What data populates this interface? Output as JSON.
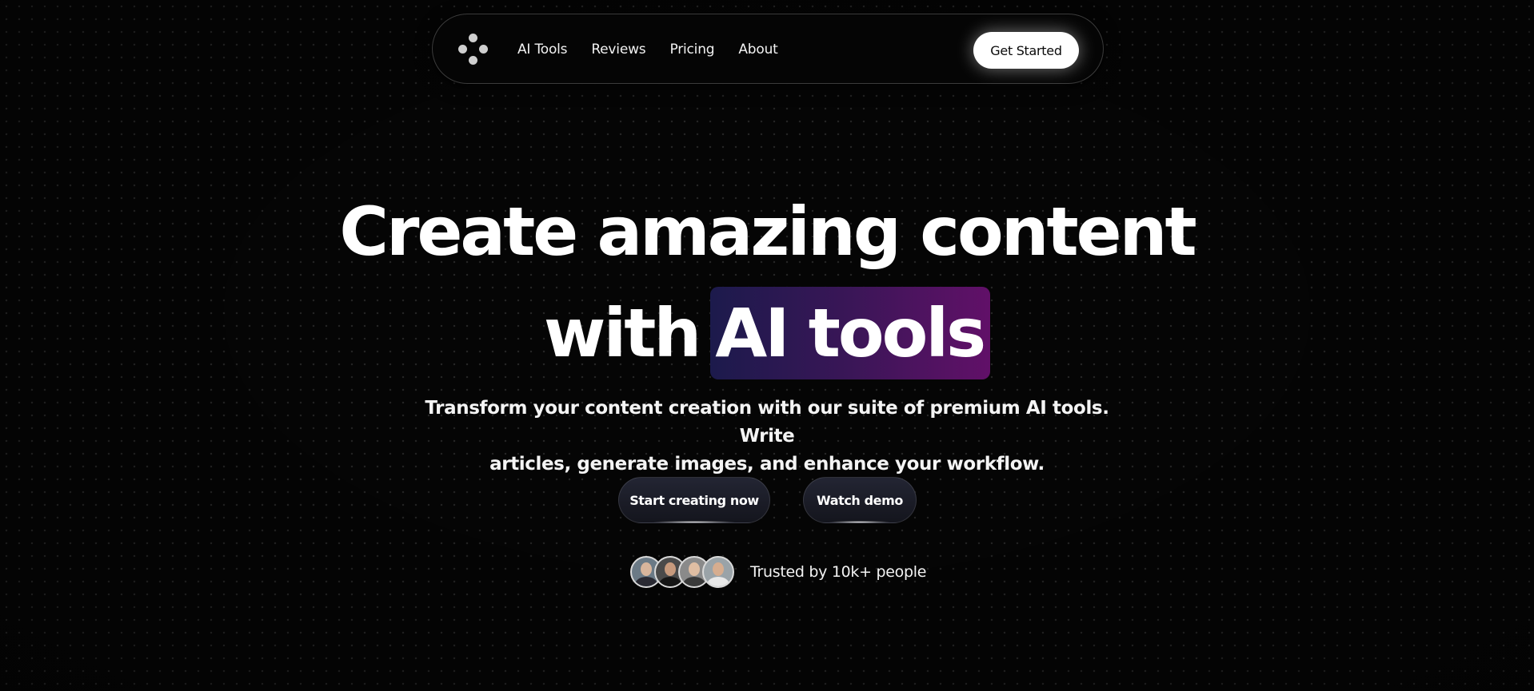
{
  "nav": {
    "logo": "four-dot-logo-icon",
    "links": [
      "AI Tools",
      "Reviews",
      "Pricing",
      "About"
    ],
    "cta_label": "Get Started"
  },
  "hero": {
    "title_line1": "Create amazing content",
    "title_line2_prefix": "with",
    "title_highlight": "AI tools",
    "highlight_gradient": [
      "#1c1a4c",
      "#611068"
    ],
    "subtitle_line1": "Transform your content creation with our suite of premium AI tools. Write",
    "subtitle_line2": "articles, generate images, and enhance your workflow."
  },
  "actions": {
    "primary_label": "Start creating now",
    "secondary_label": "Watch demo"
  },
  "trust": {
    "avatar_count": 4,
    "text": "Trusted by 10k+ people"
  },
  "colors": {
    "background": "#050505",
    "text": "#ffffff",
    "cta_background": "#ffffff"
  }
}
